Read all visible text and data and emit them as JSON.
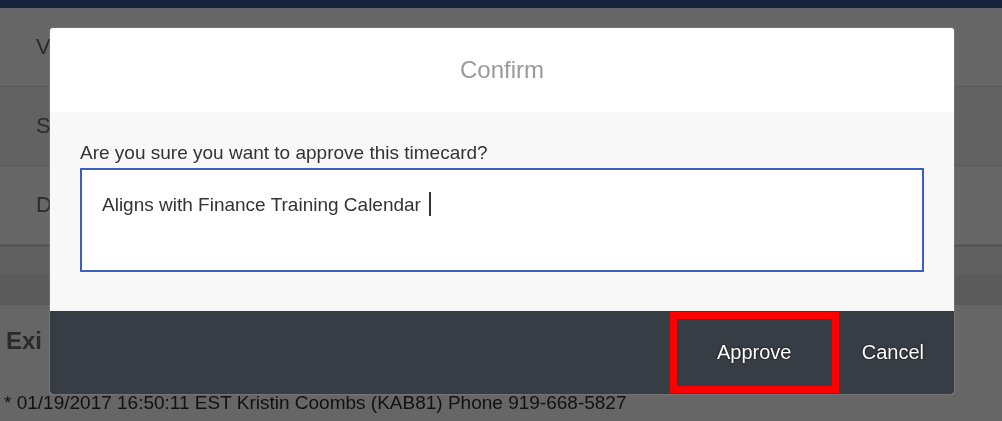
{
  "background": {
    "rows": [
      {
        "label": "V"
      },
      {
        "label": "S"
      },
      {
        "label": "D"
      }
    ],
    "section_heading": "Exi",
    "log_entry": "* 01/19/2017 16:50:11 EST Kristin Coombs (KAB81) Phone 919-668-5827"
  },
  "dialog": {
    "title": "Confirm",
    "prompt": "Are you sure you want to approve this timecard?",
    "comment": {
      "value": "Aligns with Finance Training Calendar",
      "focused": true
    },
    "buttons": [
      {
        "label": "Approve",
        "highlighted": true
      },
      {
        "label": "Cancel",
        "highlighted": false
      }
    ]
  }
}
